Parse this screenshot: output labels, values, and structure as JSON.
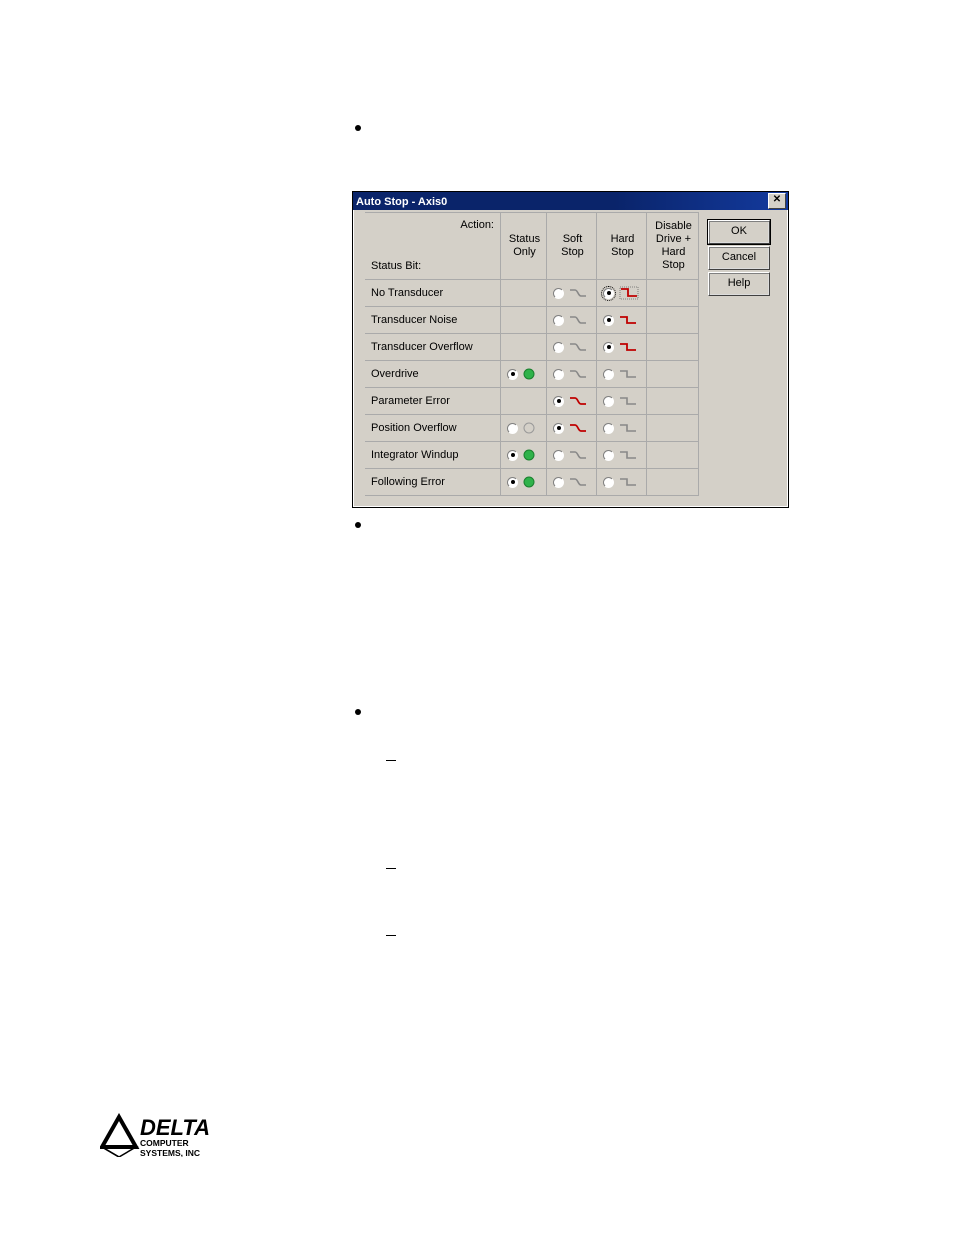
{
  "dialog": {
    "title": "Auto Stop - Axis0",
    "buttons": {
      "ok": "OK",
      "cancel": "Cancel",
      "help": "Help"
    },
    "header": {
      "action": "Action:",
      "status_bit": "Status Bit:",
      "cols": {
        "status_only": "Status\nOnly",
        "soft_stop": "Soft\nStop",
        "hard_stop": "Hard\nStop",
        "disable_drive": "Disable\nDrive +\nHard\nStop"
      }
    },
    "rows": [
      {
        "label": "No Transducer",
        "status_only": null,
        "soft": "off-gray",
        "hard": "on-red",
        "disable": null
      },
      {
        "label": "Transducer Noise",
        "status_only": null,
        "soft": "off-gray",
        "hard": "on-red",
        "disable": null
      },
      {
        "label": "Transducer Overflow",
        "status_only": null,
        "soft": "off-gray",
        "hard": "on-red",
        "disable": null
      },
      {
        "label": "Overdrive",
        "status_only": "on-green",
        "soft": "off-gray",
        "hard": "off-gray",
        "disable": null
      },
      {
        "label": "Parameter Error",
        "status_only": null,
        "soft": "on-red",
        "hard": "off-gray",
        "disable": null
      },
      {
        "label": "Position Overflow",
        "status_only": "off-blank",
        "soft": "on-red",
        "hard": "off-gray",
        "disable": null
      },
      {
        "label": "Integrator Windup",
        "status_only": "on-green",
        "soft": "off-gray",
        "hard": "off-gray",
        "disable": null
      },
      {
        "label": "Following Error",
        "status_only": "on-green",
        "soft": "off-gray",
        "hard": "off-gray",
        "disable": null
      }
    ]
  },
  "logo": {
    "brand": "DELTA",
    "sub1": "COMPUTER",
    "sub2": "SYSTEMS, INC"
  }
}
